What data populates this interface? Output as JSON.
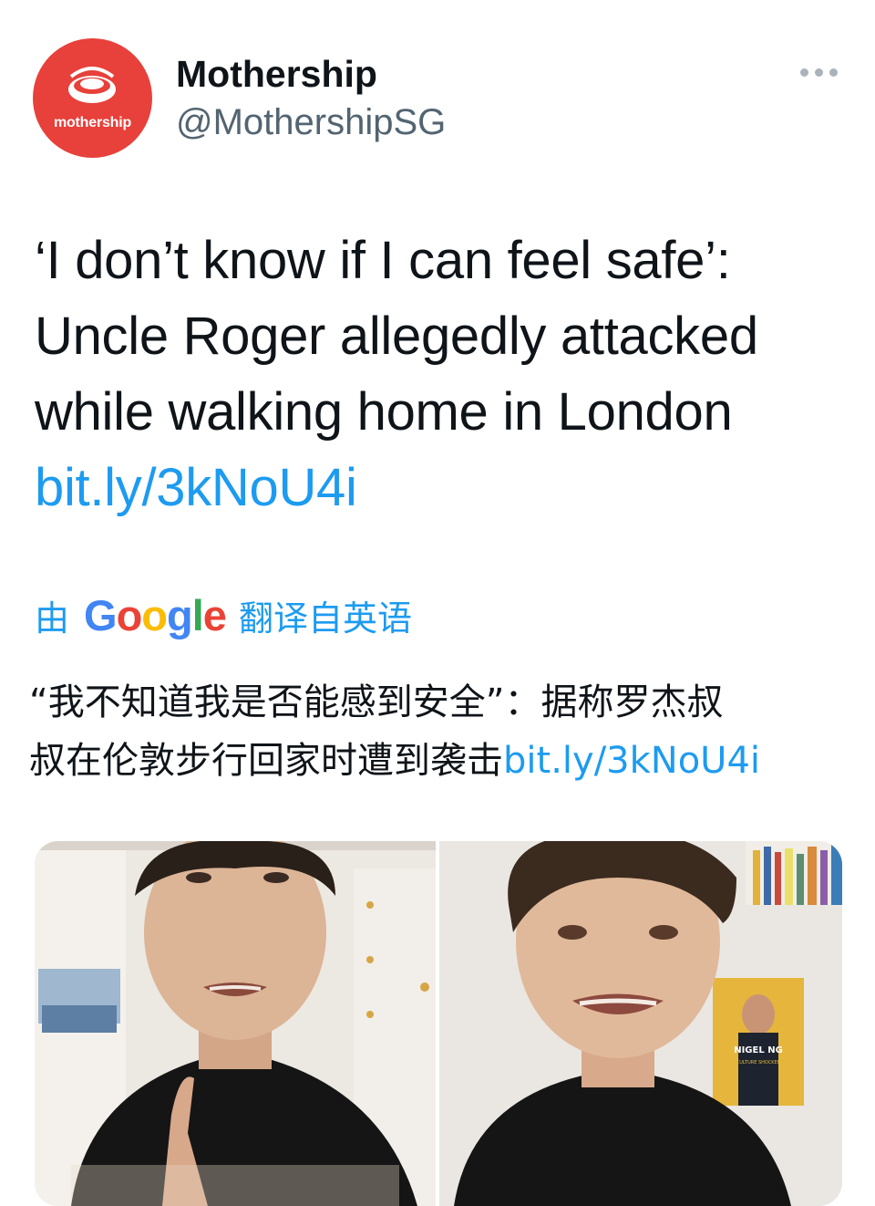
{
  "account": {
    "avatar_text": "mothership",
    "display_name": "Mothership",
    "handle": "@MothershipSG"
  },
  "more_icon": "more-horizontal-icon",
  "tweet": {
    "text_lines": [
      "‘I don’t know if I can feel safe’:",
      "Uncle Roger allegedly attacked",
      "while walking home in London"
    ],
    "link": "bit.ly/3kNoU4i"
  },
  "translation": {
    "prefix": "由",
    "provider": "Google",
    "suffix": "翻译自英语",
    "text_line1": "“我不知道我是否能感到安全”：据称罗杰叔",
    "text_line2": "叔在伦敦步行回家时遭到袭击",
    "link": "bit.ly/3kNoU4i"
  },
  "media": {
    "poster_text_line1": "NIGEL NG",
    "poster_text_line2": "CULTURE SHOCKER"
  },
  "colors": {
    "brand_red": "#e8403a",
    "link_blue": "#1d9bf0",
    "handle_gray": "#536471"
  }
}
